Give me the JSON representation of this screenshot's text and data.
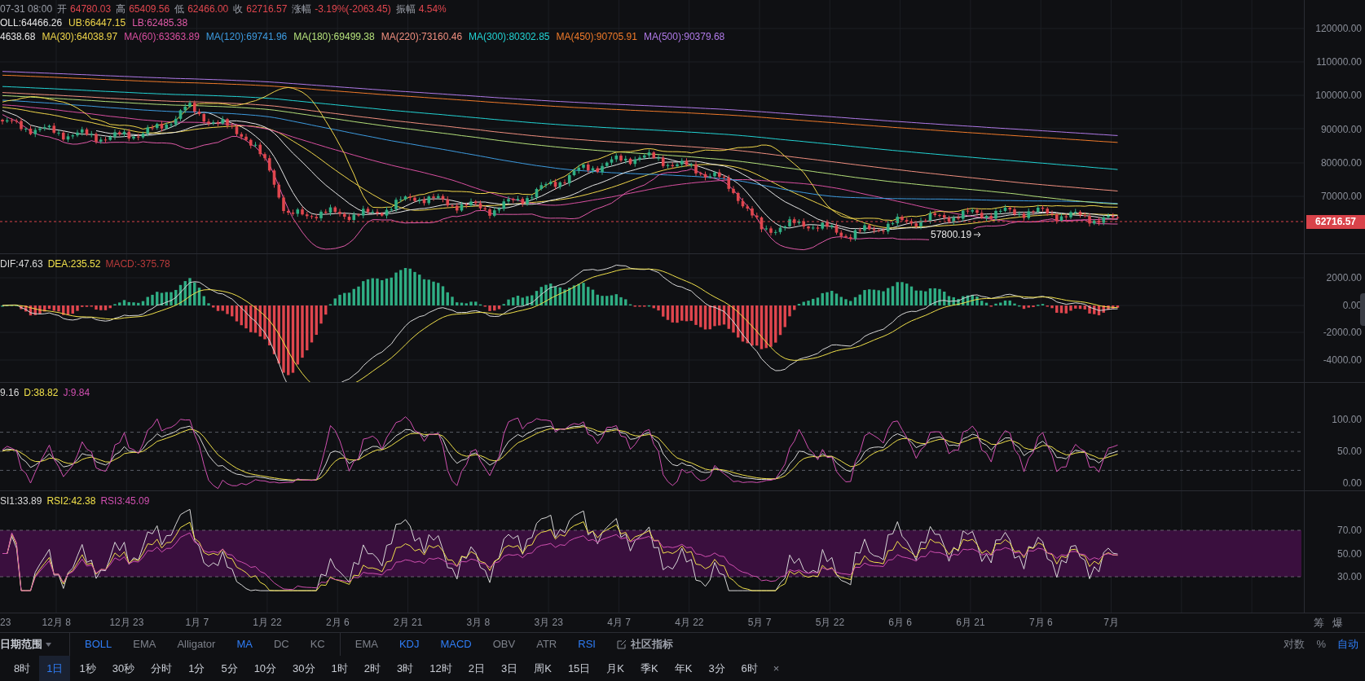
{
  "header": {
    "datetime": "07-31 08:00",
    "fields": [
      {
        "label": "开",
        "value": "64780.03"
      },
      {
        "label": "高",
        "value": "65409.56"
      },
      {
        "label": "低",
        "value": "62466.00"
      },
      {
        "label": "收",
        "value": "62716.57"
      },
      {
        "label": "涨幅",
        "value": "-3.19%(-2063.45)"
      },
      {
        "label": "振幅",
        "value": "4.54%"
      }
    ]
  },
  "boll_legend": [
    {
      "text": "OLL:64466.26",
      "color": "#e6e6e6"
    },
    {
      "text": "UB:66447.15",
      "color": "#f0d64a"
    },
    {
      "text": "LB:62485.38",
      "color": "#e05aa8"
    }
  ],
  "ma_legend": [
    {
      "text": "4638.68",
      "color": "#e6e6e6"
    },
    {
      "text": "MA(30):64038.97",
      "color": "#f0d64a"
    },
    {
      "text": "MA(60):63363.89",
      "color": "#d94fa0"
    },
    {
      "text": "MA(120):69741.96",
      "color": "#3d9be0"
    },
    {
      "text": "MA(180):69499.38",
      "color": "#b4e07a"
    },
    {
      "text": "MA(220):73160.46",
      "color": "#f08f7f"
    },
    {
      "text": "MA(300):80302.85",
      "color": "#22d3d3"
    },
    {
      "text": "MA(450):90705.91",
      "color": "#f07a2a"
    },
    {
      "text": "MA(500):90379.68",
      "color": "#b07ae8"
    }
  ],
  "price_axis": {
    "ticks": [
      "120000.00",
      "110000.00",
      "100000.00",
      "90000.00",
      "80000.00",
      "70000.00"
    ],
    "last_price": "62716.57"
  },
  "low_marker": "57800.19",
  "macd": {
    "legend": [
      {
        "text": "DIF:47.63",
        "color": "#d8d8d8"
      },
      {
        "text": "DEA:235.52",
        "color": "#f0e04a"
      },
      {
        "text": "MACD:-375.78",
        "color": "#b83a3a"
      }
    ],
    "ticks": [
      "2000.00",
      "0.00",
      "-2000.00",
      "-4000.00"
    ]
  },
  "kdj": {
    "legend": [
      {
        "text": "9.16",
        "color": "#d8d8d8"
      },
      {
        "text": "D:38.82",
        "color": "#f0e04a"
      },
      {
        "text": "J:9.84",
        "color": "#d04fb0"
      }
    ],
    "ticks": [
      "100.00",
      "50.00",
      "0.00"
    ]
  },
  "rsi": {
    "legend": [
      {
        "text": "SI1:33.89",
        "color": "#d8d8d8"
      },
      {
        "text": "RSI2:42.38",
        "color": "#f0e04a"
      },
      {
        "text": "RSI3:45.09",
        "color": "#d04fb0"
      }
    ],
    "ticks": [
      "70.00",
      "50.00",
      "30.00"
    ]
  },
  "x_axis": {
    "labels": [
      "23",
      "12月 8",
      "12月 23",
      "1月 7",
      "1月 22",
      "2月 6",
      "2月 21",
      "3月 8",
      "3月 23",
      "4月 7",
      "4月 22",
      "5月 7",
      "5月 22",
      "6月 6",
      "6月 21",
      "7月 6",
      "7月"
    ],
    "side_buttons": [
      "筹",
      "爆"
    ]
  },
  "indicator_bar": {
    "date_range": "日期范围",
    "main": [
      {
        "label": "BOLL",
        "selected": true
      },
      {
        "label": "EMA",
        "selected": false
      },
      {
        "label": "Alligator",
        "selected": false
      },
      {
        "label": "MA",
        "selected": true
      },
      {
        "label": "DC",
        "selected": false
      },
      {
        "label": "KC",
        "selected": false
      }
    ],
    "sub": [
      {
        "label": "EMA",
        "selected": false
      },
      {
        "label": "KDJ",
        "selected": true
      },
      {
        "label": "MACD",
        "selected": true
      },
      {
        "label": "OBV",
        "selected": false
      },
      {
        "label": "ATR",
        "selected": false
      },
      {
        "label": "RSI",
        "selected": true
      }
    ],
    "community": "社区指标",
    "scale": [
      {
        "label": "对数",
        "selected": false
      },
      {
        "label": "%",
        "selected": false
      },
      {
        "label": "自动",
        "selected": true
      }
    ]
  },
  "intervals": [
    {
      "label": "8时",
      "selected": false
    },
    {
      "label": "1日",
      "selected": true
    },
    {
      "label": "1秒",
      "selected": false
    },
    {
      "label": "30秒",
      "selected": false
    },
    {
      "label": "分时",
      "selected": false
    },
    {
      "label": "1分",
      "selected": false
    },
    {
      "label": "5分",
      "selected": false
    },
    {
      "label": "10分",
      "selected": false
    },
    {
      "label": "30分",
      "selected": false
    },
    {
      "label": "1时",
      "selected": false
    },
    {
      "label": "2时",
      "selected": false
    },
    {
      "label": "3时",
      "selected": false
    },
    {
      "label": "12时",
      "selected": false
    },
    {
      "label": "2日",
      "selected": false
    },
    {
      "label": "3日",
      "selected": false
    },
    {
      "label": "周K",
      "selected": false
    },
    {
      "label": "15日",
      "selected": false
    },
    {
      "label": "月K",
      "selected": false
    },
    {
      "label": "季K",
      "selected": false
    },
    {
      "label": "年K",
      "selected": false
    },
    {
      "label": "3分",
      "selected": false
    },
    {
      "label": "6时",
      "selected": false
    }
  ],
  "close_label": "×"
}
